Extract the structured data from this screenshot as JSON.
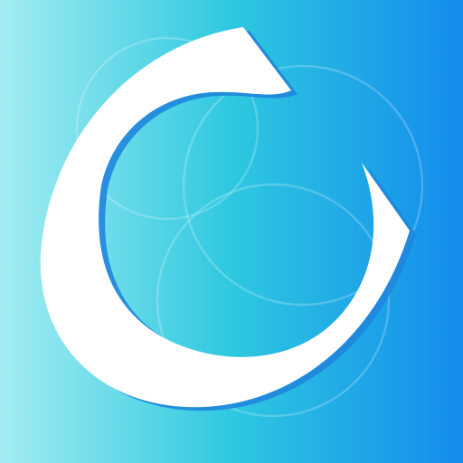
{
  "icon": {
    "name": "c-letter-logo-icon",
    "gradient": {
      "left": "#a4edf2",
      "middle": "#2ec8e0",
      "right": "#138cec"
    },
    "logo_color": "#ffffff",
    "logo_shadow_color": "#1f86dd",
    "ring_color": "#ffffff"
  }
}
